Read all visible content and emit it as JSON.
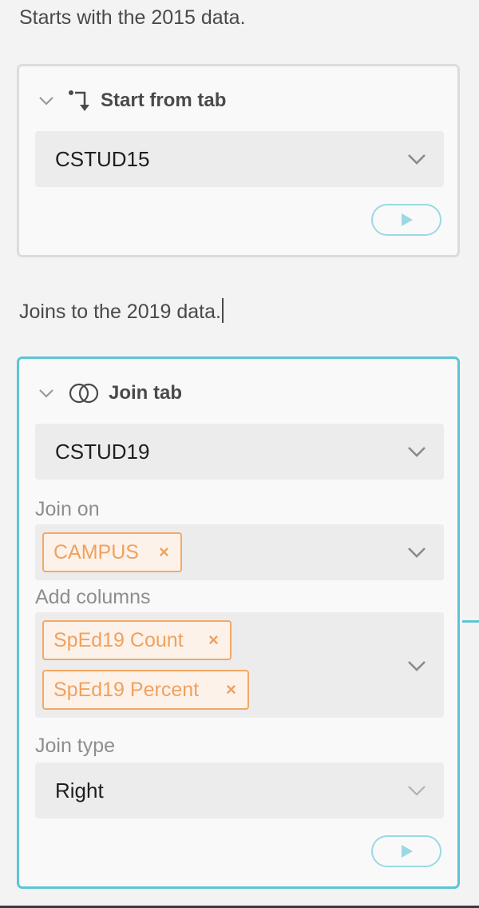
{
  "step1": {
    "note": "Starts with the 2015 data.",
    "title": "Start from tab",
    "tab_select": {
      "value": "CSTUD15"
    }
  },
  "step2": {
    "note": "Joins to the 2019 data.",
    "title": "Join tab",
    "tab_select": {
      "value": "CSTUD19"
    },
    "join_on": {
      "label": "Join on",
      "tags": [
        {
          "label": "CAMPUS",
          "remove": "×"
        }
      ]
    },
    "add_columns": {
      "label": "Add columns",
      "tags": [
        {
          "label": "SpEd19 Count",
          "remove": "×"
        },
        {
          "label": "SpEd19 Percent",
          "remove": "×"
        }
      ]
    },
    "join_type": {
      "label": "Join type",
      "value": "Right"
    }
  },
  "colors": {
    "active_border": "#5cc5d4",
    "tag_text": "#f0a15e",
    "tag_border": "#f3a866",
    "run_button_border": "#9ad9e3"
  },
  "icons": [
    "chevron-down-icon",
    "start-from-tab-icon",
    "join-venn-icon",
    "play-icon",
    "remove-tag-icon"
  ]
}
